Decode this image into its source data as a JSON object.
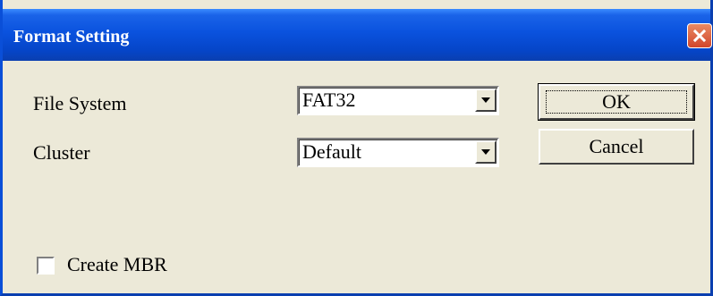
{
  "window": {
    "title": "Format Setting",
    "close_icon": "close-icon"
  },
  "fields": {
    "file_system": {
      "label": "File System",
      "value": "FAT32"
    },
    "cluster": {
      "label": "Cluster",
      "value": "Default"
    }
  },
  "buttons": {
    "ok": "OK",
    "cancel": "Cancel"
  },
  "options": {
    "create_mbr": {
      "label": "Create MBR",
      "checked": false
    }
  },
  "colors": {
    "titlebar": "#0a52de",
    "dialog_background": "#ece9d8",
    "close_button": "#d2462b"
  }
}
